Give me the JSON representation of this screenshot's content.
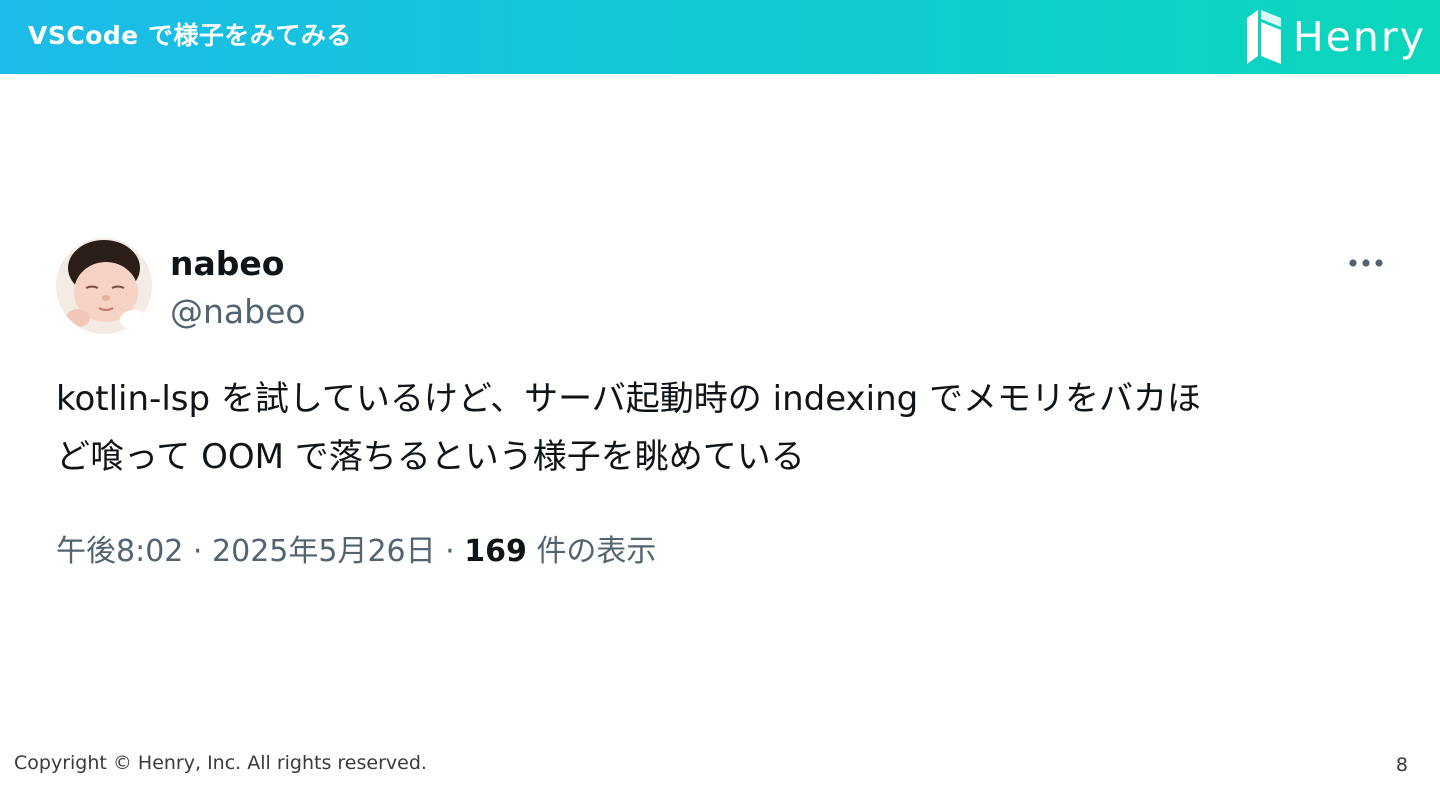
{
  "header": {
    "title": "VSCode で様子をみてみる",
    "logo_text": "Henry",
    "logo_icon": "henry-logo-icon",
    "gradient_start": "#1cbbe8",
    "gradient_end": "#0bd6bb"
  },
  "tweet": {
    "display_name": "nabeo",
    "handle": "@nabeo",
    "avatar_icon": "baby-avatar",
    "more_icon": "more-horizontal-icon",
    "text_line1": "kotlin-lsp を試しているけど、サーバ起動時の indexing でメモリをバカほ",
    "text_line2": "ど喰って OOM で落ちるという様子を眺めている",
    "time": "午後8:02",
    "date": "2025年5月26日",
    "views_count": "169",
    "views_label": "件の表示",
    "separator": "·"
  },
  "footer": {
    "copyright": "Copyright © Henry, Inc. All rights reserved.",
    "page_number": "8"
  }
}
